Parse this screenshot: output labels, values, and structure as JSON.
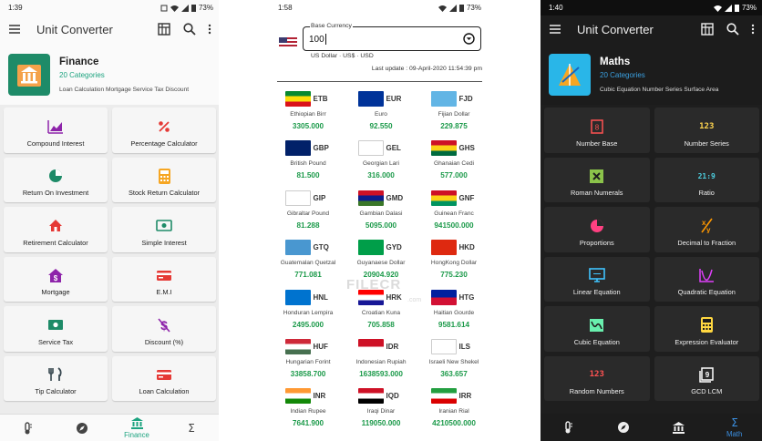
{
  "finance": {
    "status": {
      "time": "1:39",
      "battery": "73%"
    },
    "appbar": {
      "title": "Unit Converter"
    },
    "header": {
      "title": "Finance",
      "subtitle": "20 Categories",
      "description": "Loan Calculation Mortgage Service Tax Discount"
    },
    "cards": [
      {
        "label": "Compound Interest",
        "icon": "chart-icon"
      },
      {
        "label": "Percentage Calculator",
        "icon": "percent-icon"
      },
      {
        "label": "Return On Investment",
        "icon": "pie-chart-icon"
      },
      {
        "label": "Stock Return Calculator",
        "icon": "calculator-icon"
      },
      {
        "label": "Retirement Calculator",
        "icon": "home-icon"
      },
      {
        "label": "Simple Interest",
        "icon": "money-icon"
      },
      {
        "label": "Mortgage",
        "icon": "house-dollar-icon"
      },
      {
        "label": "E.M.I",
        "icon": "card-icon"
      },
      {
        "label": "Service Tax",
        "icon": "cash-icon"
      },
      {
        "label": "Discount (%)",
        "icon": "dollar-off-icon"
      },
      {
        "label": "Tip Calculator",
        "icon": "cutlery-icon"
      },
      {
        "label": "Loan Calculation",
        "icon": "card-icon"
      }
    ],
    "bottom_nav": [
      {
        "label": "",
        "icon": "thermometer-icon"
      },
      {
        "label": "",
        "icon": "compass-icon"
      },
      {
        "label": "Finance",
        "icon": "bank-icon"
      },
      {
        "label": "",
        "icon": "sigma-icon"
      }
    ]
  },
  "currency": {
    "status": {
      "time": "1:58",
      "battery": "73%"
    },
    "base": {
      "label": "Base Currency",
      "value": "100",
      "currency_name": "US Dollar · US$ · USD"
    },
    "last_update": "Last update : 09-April-2020 11:54:39 pm",
    "watermark": "FILECR",
    "watermark_sub": ".com",
    "currencies": [
      {
        "code": "ETB",
        "name": "Ethiopian Birr",
        "value": "3305.000",
        "flag": [
          "#078930",
          "#fcdd09",
          "#da121a"
        ]
      },
      {
        "code": "EUR",
        "name": "Euro",
        "value": "92.550",
        "flag": [
          "#003399"
        ]
      },
      {
        "code": "FJD",
        "name": "Fijian Dollar",
        "value": "229.875",
        "flag": [
          "#62b5e5"
        ]
      },
      {
        "code": "GBP",
        "name": "British Pound",
        "value": "81.500",
        "flag": [
          "#012169"
        ]
      },
      {
        "code": "GEL",
        "name": "Georgian Lari",
        "value": "316.000",
        "flag": [
          "#ffffff"
        ]
      },
      {
        "code": "GHS",
        "name": "Ghanaian Cedi",
        "value": "577.000",
        "flag": [
          "#ce1126",
          "#fcd116",
          "#006b3f"
        ]
      },
      {
        "code": "GIP",
        "name": "Gibraltar Pound",
        "value": "81.288",
        "flag": [
          "#ffffff"
        ]
      },
      {
        "code": "GMD",
        "name": "Gambian Dalasi",
        "value": "5095.000",
        "flag": [
          "#ce1126",
          "#0c1c8c",
          "#3a7728"
        ]
      },
      {
        "code": "GNF",
        "name": "Guinean Franc",
        "value": "941500.000",
        "flag": [
          "#ce1126",
          "#fcd116",
          "#009460"
        ]
      },
      {
        "code": "GTQ",
        "name": "Guatemalan Quetzal",
        "value": "771.081",
        "flag": [
          "#4997d0"
        ]
      },
      {
        "code": "GYD",
        "name": "Guyanaese Dollar",
        "value": "20904.920",
        "flag": [
          "#009e49"
        ]
      },
      {
        "code": "HKD",
        "name": "HongKong Dollar",
        "value": "775.230",
        "flag": [
          "#de2910"
        ]
      },
      {
        "code": "HNL",
        "name": "Honduran Lempira",
        "value": "2495.000",
        "flag": [
          "#0073cf"
        ]
      },
      {
        "code": "HRK",
        "name": "Croatian Kuna",
        "value": "705.858",
        "flag": [
          "#ff0000",
          "#ffffff",
          "#171796"
        ]
      },
      {
        "code": "HTG",
        "name": "Haitian Gourde",
        "value": "9581.614",
        "flag": [
          "#00209f",
          "#d21034"
        ]
      },
      {
        "code": "HUF",
        "name": "Hungarian Forint",
        "value": "33858.700",
        "flag": [
          "#ce2939",
          "#ffffff",
          "#477050"
        ]
      },
      {
        "code": "IDR",
        "name": "Indonesian Rupiah",
        "value": "1638593.000",
        "flag": [
          "#ce1126",
          "#ffffff"
        ]
      },
      {
        "code": "ILS",
        "name": "Israeli New Shekel",
        "value": "363.657",
        "flag": [
          "#ffffff"
        ]
      },
      {
        "code": "INR",
        "name": "Indian Rupee",
        "value": "7641.900",
        "flag": [
          "#ff9933",
          "#ffffff",
          "#138808"
        ]
      },
      {
        "code": "IQD",
        "name": "Iraqi Dinar",
        "value": "119050.000",
        "flag": [
          "#ce1126",
          "#ffffff",
          "#000000"
        ]
      },
      {
        "code": "IRR",
        "name": "Iranian Rial",
        "value": "4210500.000",
        "flag": [
          "#239f40",
          "#ffffff",
          "#da0000"
        ]
      }
    ]
  },
  "maths": {
    "status": {
      "time": "1:40",
      "battery": "73%"
    },
    "appbar": {
      "title": "Unit Converter"
    },
    "header": {
      "title": "Maths",
      "subtitle": "20 Categories",
      "description": "Cubic Equation Number Series Surface Area"
    },
    "cards": [
      {
        "label": "Number Base",
        "icon": "number-base-icon",
        "color": "#ff5252"
      },
      {
        "label": "Number Series",
        "icon": "123-icon",
        "color": "#ffd54f",
        "glyph": "123"
      },
      {
        "label": "Roman Numerals",
        "icon": "roman-x-icon",
        "color": "#8bc34a"
      },
      {
        "label": "Ratio",
        "icon": "ratio-icon",
        "color": "#4dd0e1",
        "glyph": "21:9"
      },
      {
        "label": "Proportions",
        "icon": "pie-icon",
        "color": "#ff4081"
      },
      {
        "label": "Decimal to Fraction",
        "icon": "fraction-icon",
        "color": "#ff9800"
      },
      {
        "label": "Linear Equation",
        "icon": "monitor-icon",
        "color": "#40c4ff"
      },
      {
        "label": "Quadratic Equation",
        "icon": "graph-icon",
        "color": "#e040fb"
      },
      {
        "label": "Cubic Equation",
        "icon": "cubic-icon",
        "color": "#69f0ae"
      },
      {
        "label": "Expression Evaluator",
        "icon": "calculator-icon",
        "color": "#ffd740"
      },
      {
        "label": "Random Numbers",
        "icon": "random-123-icon",
        "color": "#ff5252",
        "glyph": "123"
      },
      {
        "label": "GCD LCM",
        "icon": "gcd-icon",
        "color": "#ffffff"
      }
    ],
    "bottom_nav": [
      {
        "label": "",
        "icon": "thermometer-icon"
      },
      {
        "label": "",
        "icon": "compass-icon"
      },
      {
        "label": "",
        "icon": "bank-icon"
      },
      {
        "label": "Math",
        "icon": "sigma-icon"
      }
    ]
  },
  "colors": {
    "finance_accent": "#1ca37f",
    "finance_icon": "#8e24aa",
    "maths_accent": "#3b8fe0",
    "currency_value": "#1c9a4a"
  }
}
